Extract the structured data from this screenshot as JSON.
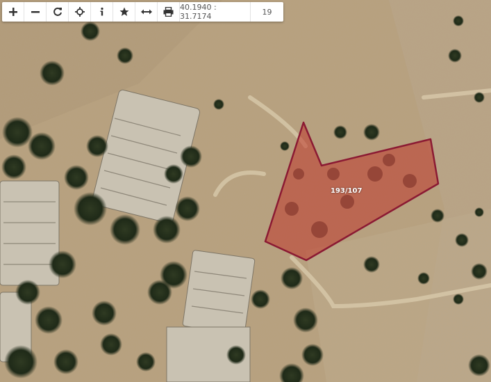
{
  "toolbar": {
    "buttons": [
      {
        "name": "zoom-in",
        "icon": "plus-icon"
      },
      {
        "name": "zoom-out",
        "icon": "minus-icon"
      },
      {
        "name": "refresh",
        "icon": "refresh-icon"
      },
      {
        "name": "locate",
        "icon": "crosshair-icon"
      },
      {
        "name": "info",
        "icon": "info-icon"
      },
      {
        "name": "favorite",
        "icon": "star-icon"
      },
      {
        "name": "measure",
        "icon": "arrows-horizontal-icon"
      },
      {
        "name": "print",
        "icon": "printer-icon"
      }
    ],
    "coordinates": "40.1940 : 31.7174",
    "zoom_level": "19"
  },
  "parcel": {
    "label": "193/107",
    "outline_color": "#8b1a33",
    "fill_color": "#c0392b"
  }
}
